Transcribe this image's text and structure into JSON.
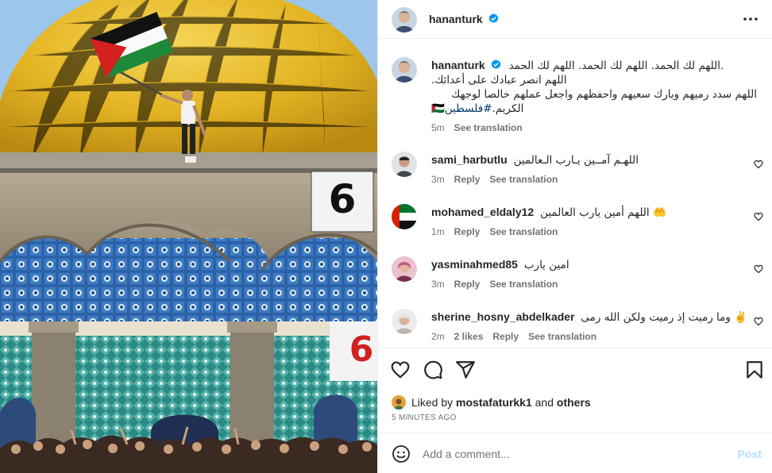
{
  "post": {
    "author": "hananturk",
    "verified": true
  },
  "caption": {
    "username": "hananturk",
    "text_line1": "اللهم لك الحمد. اللهم لك الحمد. اللهم لك الحمد.",
    "text_line2": "اللهم انصر عبادك على أعدائك.",
    "text_line3": "اللهم سدد رميهم وبارك سعيهم واحفظهم واجعل عملهم خالصا لوجهك",
    "text_line4_a": "الكريم.",
    "hashtag": "#فلسطين🇵🇸",
    "time": "5m",
    "see_translation": "See translation"
  },
  "comments": [
    {
      "username": "sami_harbutlu",
      "text": "اللهـم آمــين يـارب الـعالمين",
      "time": "3m",
      "reply": "Reply",
      "see_translation": "See translation"
    },
    {
      "username": "mohamed_eldaly12",
      "text": "اللهم أمين يارب العالمين 🤲",
      "time": "1m",
      "reply": "Reply",
      "see_translation": "See translation"
    },
    {
      "username": "yasminahmed85",
      "text": "امين يارب",
      "time": "3m",
      "reply": "Reply",
      "see_translation": "See translation"
    },
    {
      "username": "sherine_hosny_abdelkader",
      "text": "وما رميت إذ رميت ولكن الله رمى ✌️",
      "time": "2m",
      "likes": "2 likes",
      "reply": "Reply",
      "see_translation": "See translation"
    }
  ],
  "likes": {
    "prefix": "Liked by",
    "user": "mostafaturkk1",
    "joiner": "and",
    "others": "others"
  },
  "timestamp": "5 minutes ago",
  "add_comment": {
    "placeholder": "Add a comment...",
    "post_label": "Post"
  },
  "icons": {
    "more": "more-horizontal-icon",
    "like": "heart-icon",
    "comment": "comment-icon",
    "share": "share-icon",
    "save": "bookmark-icon",
    "emoji": "emoji-icon"
  },
  "colors": {
    "text": "#262626",
    "secondary": "#737373",
    "link": "#00376b",
    "verified": "#0095f6",
    "post_disabled": "#b2dffc",
    "border": "#efefef"
  }
}
